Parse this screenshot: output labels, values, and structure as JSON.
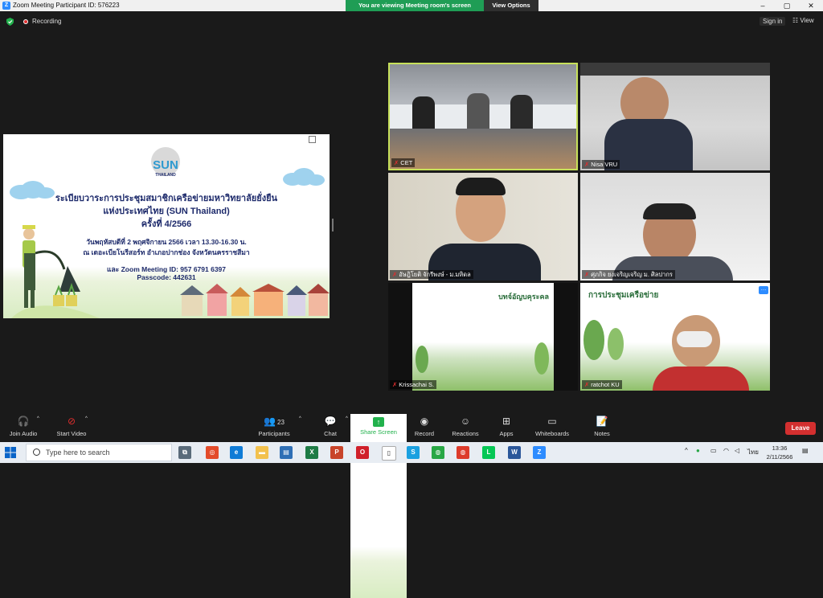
{
  "window": {
    "title": "Zoom Meeting Participant ID: 576223",
    "logo": "Z"
  },
  "banner": {
    "message": "You are viewing Meeting room's screen",
    "options": "View Options"
  },
  "window_controls": [
    "–",
    "▢",
    "✕"
  ],
  "topbar": {
    "recording": "Recording",
    "sign_in": "Sign in",
    "view": "View"
  },
  "shared_slide": {
    "logo_text": "SUN",
    "logo_sub": "THAILAND",
    "line1": "ระเบียบวาระการประชุมสมาชิกเครือข่ายมหาวิทยาลัยยั่งยืน",
    "line2": "แห่งประเทศไทย (SUN Thailand)",
    "line3": "ครั้งที่ 4/2566",
    "line4": "วันพฤหัสบดีที่ 2 พฤศจิกายน 2566 เวลา 13.30-16.30 น.",
    "line5": "ณ เดอะเบียโนรีสอร์ท อำเภอปากช่อง จังหวัดนครราชสีมา",
    "line6": "และ Zoom Meeting ID: 957 6791 6397",
    "line7": "Passcode: 442631"
  },
  "participants": [
    {
      "name": "CET",
      "muted": true,
      "active": true
    },
    {
      "name": "Nisa VRU",
      "muted": true,
      "active": false
    },
    {
      "name": "อัษฎิโยติ จักรีพงษ์ - ม.มหิดล",
      "muted": true,
      "active": false
    },
    {
      "name": "ศุภกิจ ยงเจริญเจริญ ม. ศิลปากร",
      "muted": true,
      "active": false
    },
    {
      "name": "Krissachai S.",
      "muted": true,
      "active": false
    },
    {
      "name": "ratchot KU",
      "muted": true,
      "active": false
    }
  ],
  "tile_slides": {
    "krissachai": "บทจ์อัญบคุระคล",
    "ratchot": "การประชุมเครือข่าย"
  },
  "toolbar": {
    "join_audio": "Join Audio",
    "start_video": "Start Video",
    "participants": "Participants",
    "participants_count": "23",
    "chat": "Chat",
    "share_screen": "Share Screen",
    "record": "Record",
    "reactions": "Reactions",
    "apps": "Apps",
    "whiteboards": "Whiteboards",
    "notes": "Notes",
    "leave": "Leave"
  },
  "taskbar": {
    "search_placeholder": "Type here to search",
    "time": "13:36",
    "date": "2/11/2566",
    "lang": "ไทย"
  },
  "colors": {
    "accent_green": "#22b14c",
    "leave_red": "#d32f2f",
    "active_border": "#c7e15a",
    "zoom_blue": "#2d8cff"
  }
}
